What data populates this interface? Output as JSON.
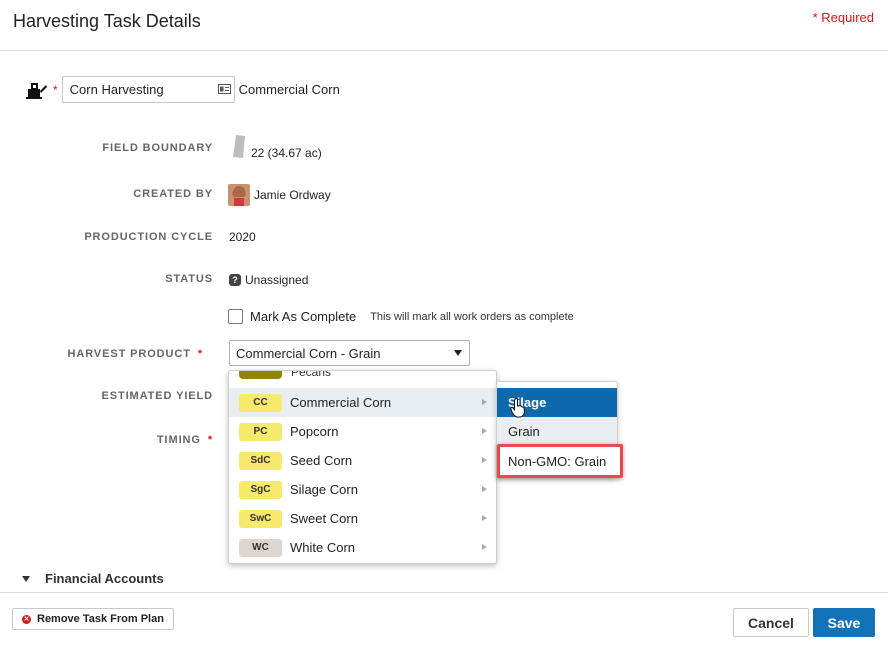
{
  "header": {
    "title": "Harvesting Task Details",
    "required_note": "* Required"
  },
  "task": {
    "name": "Corn Harvesting",
    "crop": "Commercial Corn",
    "required_star": "*"
  },
  "fields": {
    "field_boundary": {
      "label": "FIELD BOUNDARY",
      "value": "22 (34.67 ac)"
    },
    "created_by": {
      "label": "CREATED BY",
      "value": "Jamie Ordway"
    },
    "production_cycle": {
      "label": "PRODUCTION CYCLE",
      "value": "2020"
    },
    "status": {
      "label": "STATUS",
      "value": "Unassigned",
      "icon_text": "?"
    },
    "mark_complete": {
      "label": "Mark As Complete",
      "hint": "This will mark all work orders as complete",
      "checked": false
    },
    "harvest_product": {
      "label": "HARVEST PRODUCT",
      "required_star": "*",
      "value": "Commercial Corn - Grain"
    },
    "estimated_yield": {
      "label": "ESTIMATED YIELD"
    },
    "timing": {
      "label": "TIMING",
      "required_star": "*"
    }
  },
  "dropdown": {
    "partial_item": {
      "label": "Pecans",
      "color": "#8f8609"
    },
    "items": [
      {
        "code": "CC",
        "label": "Commercial Corn",
        "color": "#f7e96b",
        "hovered": true
      },
      {
        "code": "PC",
        "label": "Popcorn",
        "color": "#f7e96b"
      },
      {
        "code": "SdC",
        "label": "Seed Corn",
        "color": "#f7e96b"
      },
      {
        "code": "SgC",
        "label": "Silage Corn",
        "color": "#f7e96b"
      },
      {
        "code": "SwC",
        "label": "Sweet Corn",
        "color": "#f7e96b"
      },
      {
        "code": "WC",
        "label": "White Corn",
        "color": "#ddd6d0"
      }
    ]
  },
  "submenu": {
    "items": [
      {
        "label": "Silage",
        "selected": true
      },
      {
        "label": "Grain"
      },
      {
        "label": "Non-GMO: Grain",
        "highlighted": true
      }
    ]
  },
  "financial": {
    "label": "Financial Accounts"
  },
  "footer": {
    "remove_label": "Remove Task From Plan",
    "cancel_label": "Cancel",
    "save_label": "Save"
  },
  "colors": {
    "accent": "#1172b8",
    "required": "#d0191c",
    "highlight": "#e8494e"
  }
}
